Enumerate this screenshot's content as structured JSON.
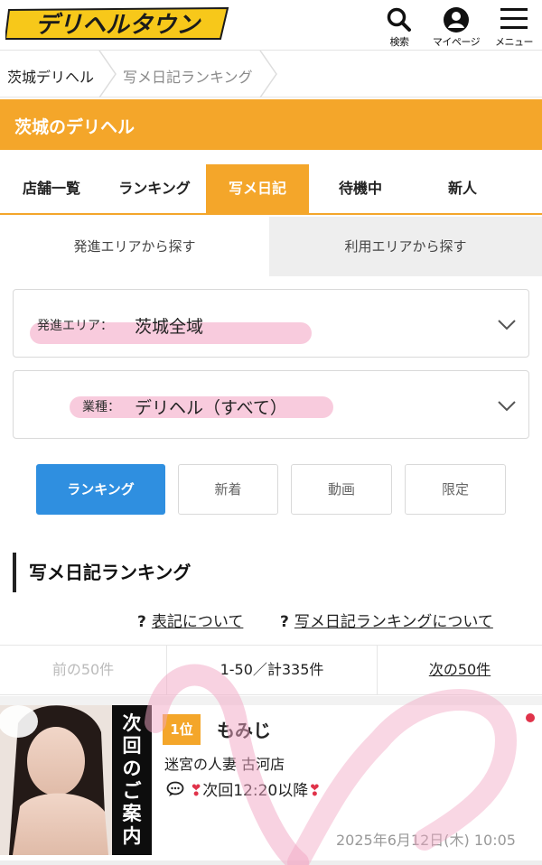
{
  "header": {
    "logo_text": "デリヘルタウン",
    "search_label": "検索",
    "mypage_label": "マイページ",
    "menu_label": "メニュー"
  },
  "breadcrumb": {
    "home": "茨城デリヘル",
    "current": "写メ日記ランキング"
  },
  "banner": {
    "title": "茨城のデリヘル"
  },
  "tabs": [
    {
      "label": "店舗一覧"
    },
    {
      "label": "ランキング"
    },
    {
      "label": "写メ日記",
      "active": true
    },
    {
      "label": "待機中"
    },
    {
      "label": "新人"
    }
  ],
  "area_tabs": {
    "dispatch": "発進エリアから探す",
    "usage": "利用エリアから探す"
  },
  "filters": {
    "area": {
      "label": "発進エリア：",
      "value": "茨城全域"
    },
    "type": {
      "label": "業種：",
      "value": "デリヘル（すべて）"
    }
  },
  "sort_buttons": [
    {
      "label": "ランキング",
      "active": true
    },
    {
      "label": "新着"
    },
    {
      "label": "動画"
    },
    {
      "label": "限定"
    }
  ],
  "section": {
    "title": "写メ日記ランキング"
  },
  "info_links": {
    "notation": "表記について",
    "ranking_about": "写メ日記ランキングについて",
    "q": "?"
  },
  "pagination": {
    "prev": "前の50件",
    "range": "1-50／計335件",
    "next": "次の50件"
  },
  "ranking": [
    {
      "rank": "1位",
      "name": "もみじ",
      "shop": "迷宮の人妻 古河店",
      "message": "次回12:20以降",
      "heart": "❣",
      "date": "2025年6月12日(木) 10:05",
      "guide_text": [
        "次",
        "回",
        "の",
        "ご",
        "案",
        "内"
      ]
    }
  ],
  "colors": {
    "accent_orange": "#f4a62a",
    "button_blue": "#2f8fe0",
    "marker_pink": "#f08cb4",
    "new_dot": "#e0334a"
  },
  "icons": {
    "search": "search-icon",
    "mypage": "user-circle-icon",
    "menu": "hamburger-icon",
    "chevron": "chevron-down-icon",
    "comment": "speech-bubble-icon"
  }
}
